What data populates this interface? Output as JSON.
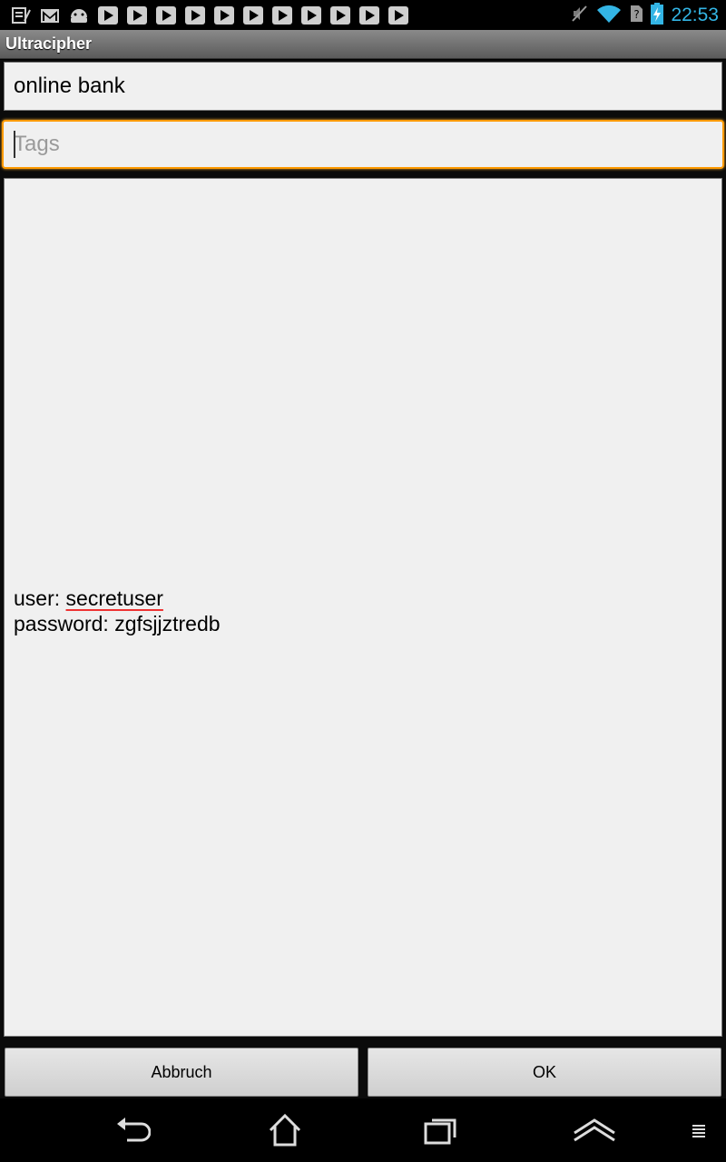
{
  "status_bar": {
    "time": "22:53",
    "left_icons": [
      "notes-icon",
      "gmail-icon",
      "android-icon",
      "play-store-icon",
      "play-store-icon",
      "play-store-icon",
      "play-store-icon",
      "play-store-icon",
      "play-store-icon",
      "play-store-icon",
      "play-store-icon",
      "play-store-icon",
      "play-store-icon",
      "play-store-icon"
    ],
    "right_icons": [
      "mute-icon",
      "wifi-icon",
      "no-sim-icon",
      "battery-charging-icon"
    ],
    "accent_color": "#33b5e5"
  },
  "app": {
    "title": "Ultracipher"
  },
  "form": {
    "name_value": "online bank",
    "tags_value": "",
    "tags_placeholder": "Tags",
    "body_line1_prefix": "user: ",
    "body_line1_value": "secretuser",
    "body_line2": "password: zgfsjjztredb",
    "focus_color": "#ff9a00"
  },
  "buttons": {
    "cancel_label": "Abbruch",
    "ok_label": "OK"
  },
  "nav_bar": {
    "icons": [
      "back-icon",
      "home-icon",
      "recent-apps-icon",
      "hide-keyboard-icon",
      "menu-icon"
    ]
  }
}
